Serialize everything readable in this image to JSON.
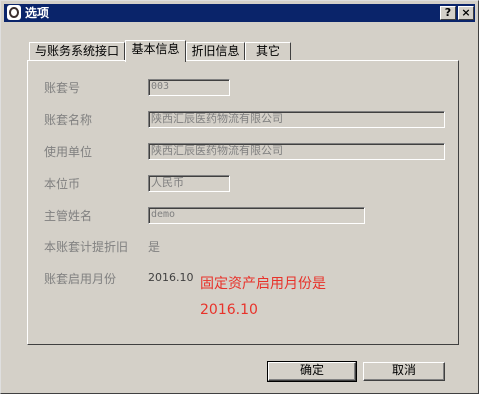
{
  "window": {
    "title": "选项",
    "help_glyph": "?",
    "close_glyph": "×"
  },
  "tabs": [
    {
      "label": "与账务系统接口",
      "active": false
    },
    {
      "label": "基本信息",
      "active": true
    },
    {
      "label": "折旧信息",
      "active": false
    },
    {
      "label": "其它",
      "active": false
    }
  ],
  "form": {
    "account_code": {
      "label": "账套号",
      "value": "003"
    },
    "account_name": {
      "label": "账套名称",
      "value": "陕西汇辰医药物流有限公司"
    },
    "unit": {
      "label": "使用单位",
      "value": "陕西汇辰医药物流有限公司"
    },
    "currency": {
      "label": "本位币",
      "value": "人民币"
    },
    "supervisor": {
      "label": "主管姓名",
      "value": "demo"
    },
    "depreciation": {
      "label": "本账套计提折旧",
      "value": "是"
    },
    "start_month": {
      "label": "账套启用月份",
      "value": "2016.10"
    }
  },
  "annotation": {
    "line1": "固定资产启用月份是",
    "line2": "2016.10",
    "color": "#e8322a"
  },
  "buttons": {
    "ok": "确定",
    "cancel": "取消"
  }
}
